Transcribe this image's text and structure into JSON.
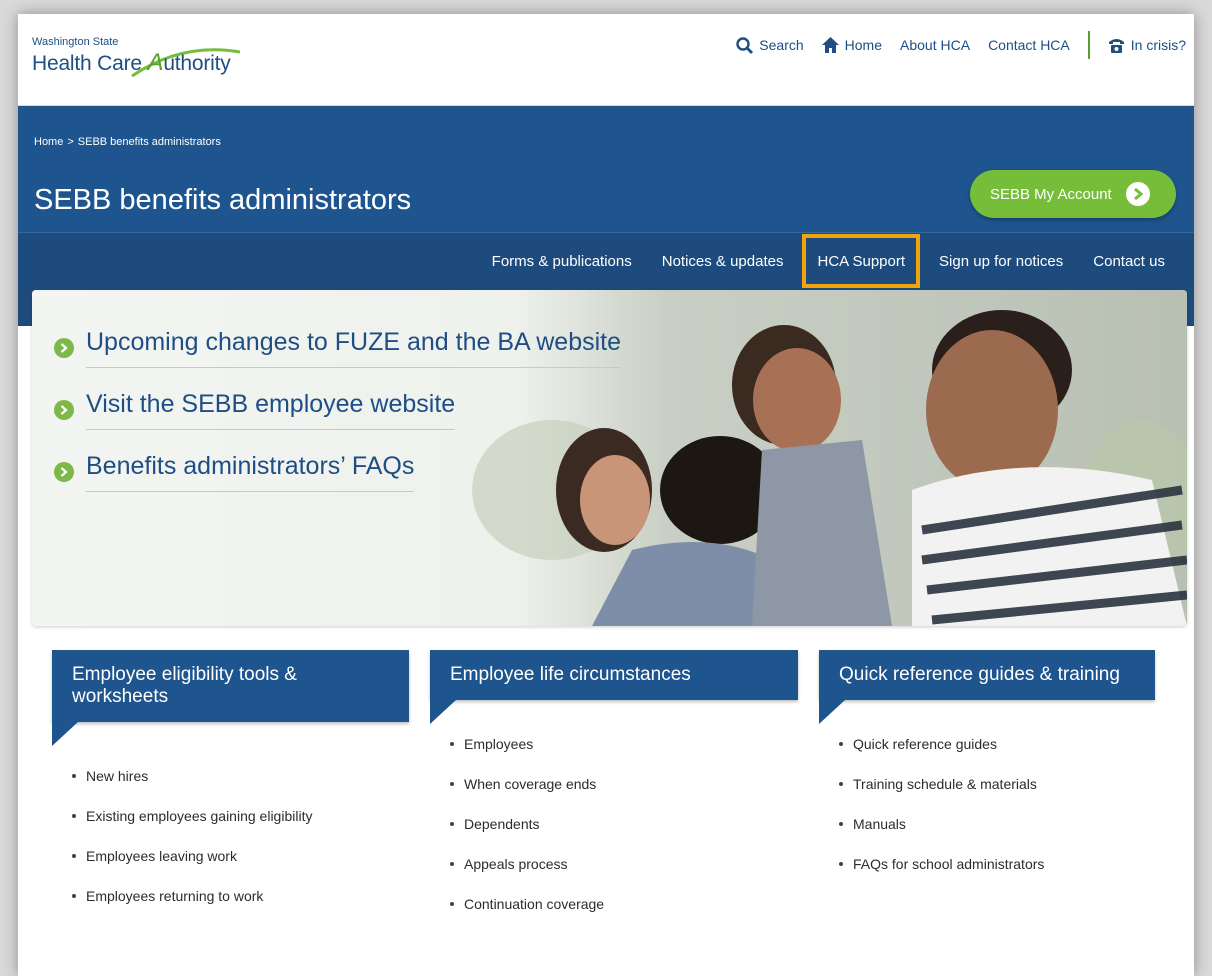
{
  "logo": {
    "line1": "Washington State",
    "line2_prefix": "Health Care ",
    "line2_accent": "A",
    "line2_suffix": "uthority"
  },
  "utility": {
    "search": "Search",
    "home": "Home",
    "about": "About HCA",
    "contact": "Contact HCA",
    "crisis": "In crisis?"
  },
  "breadcrumb": {
    "home": "Home",
    "separator": ">",
    "current": "SEBB benefits administrators"
  },
  "page_title": "SEBB benefits administrators",
  "account_button": "SEBB My Account",
  "nav": [
    {
      "label": "Forms & publications"
    },
    {
      "label": "Notices & updates"
    },
    {
      "label": "HCA Support"
    },
    {
      "label": "Sign up for notices"
    },
    {
      "label": "Contact us"
    }
  ],
  "hero_links": [
    "Upcoming changes to FUZE and the BA website",
    "Visit the SEBB employee website",
    "Benefits administrators’ FAQs"
  ],
  "columns": [
    {
      "title": "Employee eligibility tools & worksheets",
      "items": [
        "New hires",
        "Existing employees gaining eligibility",
        "Employees leaving work",
        "Employees returning to work"
      ]
    },
    {
      "title": "Employee life circumstances",
      "items": [
        "Employees",
        "When coverage ends",
        "Dependents",
        "Appeals process",
        "Continuation coverage"
      ]
    },
    {
      "title": "Quick reference guides & training",
      "items": [
        "Quick reference guides",
        "Training schedule & materials",
        "Manuals",
        "FAQs for school administrators"
      ]
    }
  ],
  "colors": {
    "brand_blue": "#1e558f",
    "brand_green": "#76bd3a",
    "highlight": "#f0a30a"
  }
}
